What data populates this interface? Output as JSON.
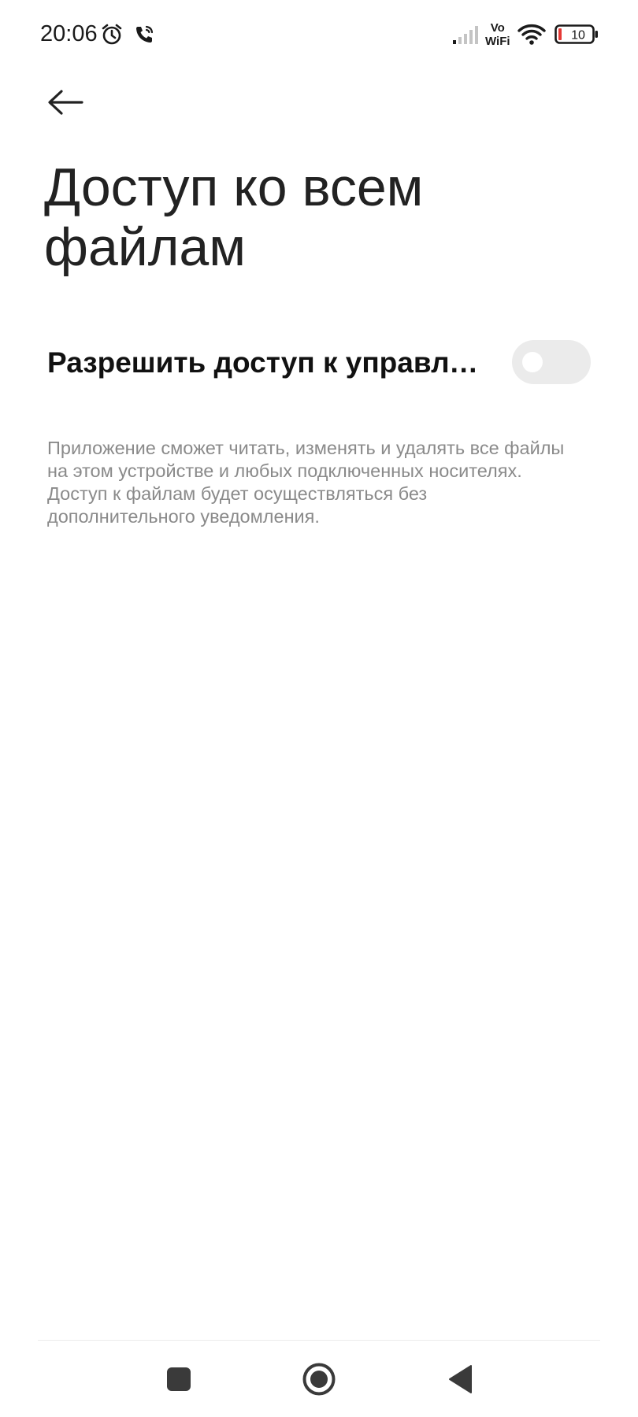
{
  "status_bar": {
    "time": "20:06",
    "icons": [
      "alarm-icon",
      "wifi-call-icon",
      "signal-icon",
      "vowifi-icon",
      "wifi-icon",
      "battery-icon"
    ],
    "vowifi_top": "Vo",
    "vowifi_bottom": "WiFi",
    "battery_level": "10",
    "battery_low_color": "#e53935"
  },
  "header": {
    "back_icon": "arrow-left-icon",
    "title_line1": "Доступ ко всем",
    "title_line2": "файлам"
  },
  "setting": {
    "label": "Разрешить доступ к управлению всеми файлами",
    "enabled": false,
    "description": "Приложение сможет читать, изменять и удалять все файлы на этом устройстве и любых подключенных носителях. Доступ к файлам будет осуществляться без дополнительного уведомления."
  },
  "nav_bar": {
    "buttons": [
      "recents-square-icon",
      "home-circle-icon",
      "back-triangle-icon"
    ]
  }
}
